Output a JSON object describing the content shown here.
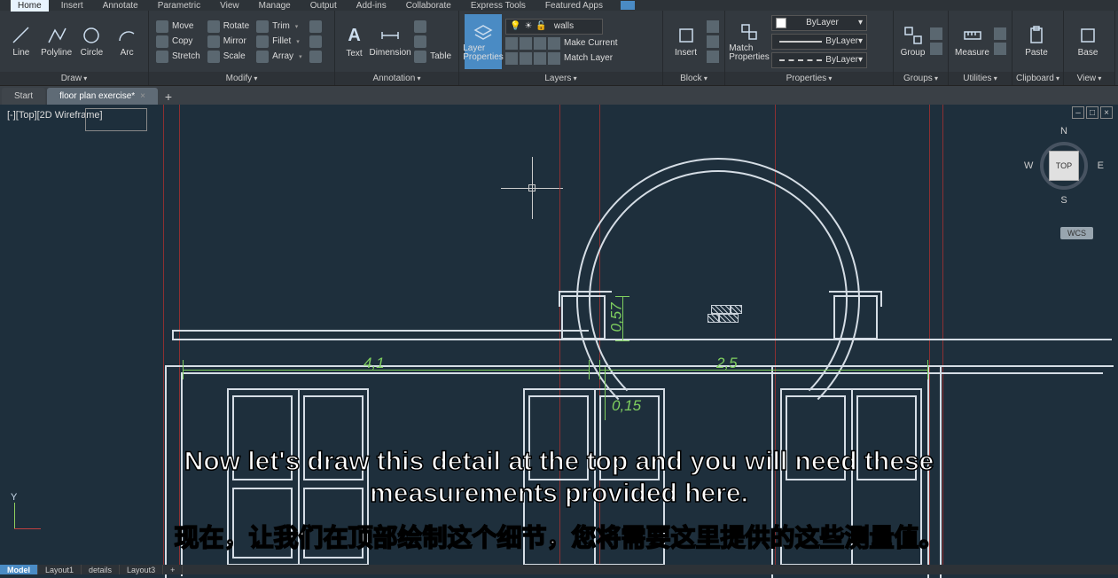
{
  "menu": {
    "items": [
      "Home",
      "Insert",
      "Annotate",
      "Parametric",
      "View",
      "Manage",
      "Output",
      "Add-ins",
      "Collaborate",
      "Express Tools",
      "Featured Apps"
    ],
    "active": "Home"
  },
  "ribbon": {
    "draw": {
      "title": "Draw",
      "line": "Line",
      "polyline": "Polyline",
      "circle": "Circle",
      "arc": "Arc"
    },
    "modify": {
      "title": "Modify",
      "move": "Move",
      "rotate": "Rotate",
      "trim": "Trim",
      "copy": "Copy",
      "mirror": "Mirror",
      "fillet": "Fillet",
      "stretch": "Stretch",
      "scale": "Scale",
      "array": "Array"
    },
    "annotation": {
      "title": "Annotation",
      "text": "Text",
      "dimension": "Dimension",
      "table": "Table"
    },
    "layers": {
      "title": "Layers",
      "properties": "Layer Properties",
      "current": "walls",
      "makecurrent": "Make Current",
      "matchlayer": "Match Layer"
    },
    "block": {
      "title": "Block",
      "insert": "Insert"
    },
    "properties": {
      "title": "Properties",
      "match": "Match Properties",
      "bylayer": "ByLayer"
    },
    "groups": {
      "title": "Groups",
      "group": "Group"
    },
    "utilities": {
      "title": "Utilities",
      "measure": "Measure"
    },
    "clipboard": {
      "title": "Clipboard",
      "paste": "Paste"
    },
    "view": {
      "title": "View",
      "base": "Base"
    }
  },
  "tabs": {
    "start": "Start",
    "file": "floor plan exercise*"
  },
  "viewport": {
    "label": "[-][Top][2D Wireframe]",
    "min": "–",
    "max": "□",
    "close": "×"
  },
  "viewcube": {
    "n": "N",
    "s": "S",
    "e": "E",
    "w": "W",
    "face": "TOP"
  },
  "wcs": "WCS",
  "dimensions": {
    "d1": "4,1",
    "d2": "0,57",
    "d3": "0,15",
    "d4": "2,5"
  },
  "ucs": {
    "y": "Y"
  },
  "subtitle_en": "Now let's draw this detail at the top and you will need these measurements provided here.",
  "subtitle_zh": "现在，让我们在顶部绘制这个细节，您将需要这里提供的这些测量值。",
  "layouts": {
    "model": "Model",
    "l1": "Layout1",
    "l2": "details",
    "l3": "Layout3",
    "add": "+"
  }
}
